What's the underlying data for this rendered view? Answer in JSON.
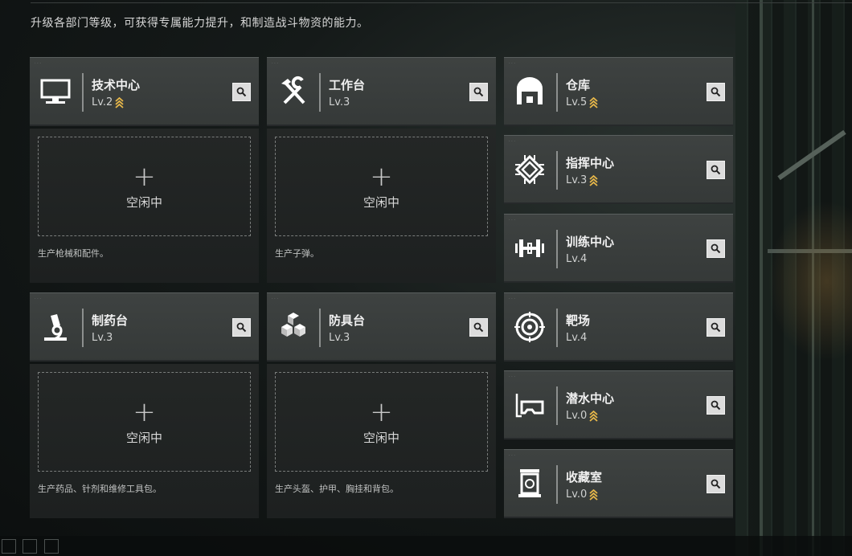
{
  "header": {
    "subtitle": "升级各部门等级，可获得专属能力提升，和制造战斗物资的能力。"
  },
  "colors": {
    "accent_upgrade": "#e8b84a",
    "panel": "#3b3f3e",
    "slot": "#212424"
  },
  "idle": {
    "plus": "+",
    "label": "空闲中"
  },
  "facilities": [
    {
      "name": "技术中心",
      "level": "Lv.2",
      "upgradable": true,
      "icon": "monitor-icon",
      "slot_desc": "生产枪械和配件。"
    },
    {
      "name": "工作台",
      "level": "Lv.3",
      "upgradable": false,
      "icon": "tools-icon",
      "slot_desc": "生产子弹。"
    },
    {
      "name": "仓库",
      "level": "Lv.5",
      "upgradable": true,
      "icon": "warehouse-icon"
    },
    {
      "name": "指挥中心",
      "level": "Lv.3",
      "upgradable": true,
      "icon": "chip-icon"
    },
    {
      "name": "训练中心",
      "level": "Lv.4",
      "upgradable": false,
      "icon": "dumbbell-icon"
    },
    {
      "name": "制药台",
      "level": "Lv.3",
      "upgradable": false,
      "icon": "microscope-icon",
      "slot_desc": "生产药品、针剂和维修工具包。"
    },
    {
      "name": "防具台",
      "level": "Lv.3",
      "upgradable": false,
      "icon": "armor-blocks-icon",
      "slot_desc": "生产头盔、护甲、胸挂和背包。"
    },
    {
      "name": "靶场",
      "level": "Lv.4",
      "upgradable": false,
      "icon": "target-icon"
    },
    {
      "name": "潜水中心",
      "level": "Lv.0",
      "upgradable": true,
      "icon": "dive-mask-icon"
    },
    {
      "name": "收藏室",
      "level": "Lv.0",
      "upgradable": true,
      "icon": "collection-icon"
    }
  ]
}
